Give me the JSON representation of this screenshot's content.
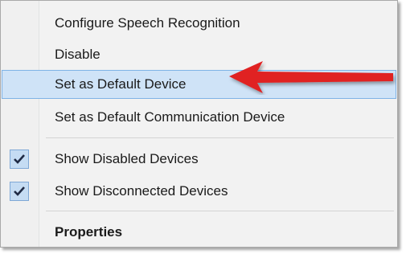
{
  "context_menu": {
    "items": [
      {
        "label": "Configure Speech Recognition"
      },
      {
        "label": "Disable"
      },
      {
        "label": "Set as Default Device"
      },
      {
        "label": "Set as Default Communication Device"
      },
      {
        "label": "Show Disabled Devices",
        "checked": true
      },
      {
        "label": "Show Disconnected Devices",
        "checked": true
      },
      {
        "label": "Properties"
      }
    ]
  },
  "colors": {
    "highlight_bg": "#cfe3f7",
    "highlight_border": "#7fb3e6",
    "arrow": "#e02020"
  }
}
